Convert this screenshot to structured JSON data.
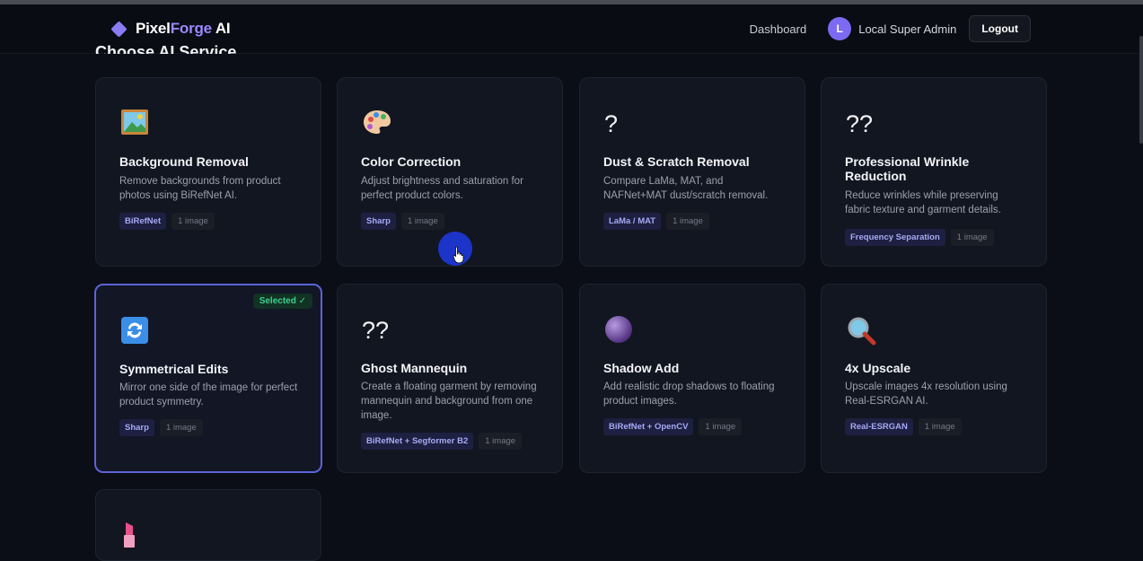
{
  "header": {
    "brand_part1": "Pixel",
    "brand_part2": "Forge",
    "brand_part3": " AI",
    "nav_dashboard": "Dashboard",
    "avatar_initial": "L",
    "user_name": "Local Super Admin",
    "logout_label": "Logout"
  },
  "section": {
    "title": "Choose AI Service"
  },
  "cards": [
    {
      "icon": "framed-picture-icon",
      "title": "Background Removal",
      "desc": "Remove backgrounds from product photos using BiRefNet AI.",
      "tech": "BiRefNet",
      "count": "1 image"
    },
    {
      "icon": "palette-icon",
      "title": "Color Correction",
      "desc": "Adjust brightness and saturation for perfect product colors.",
      "tech": "Sharp",
      "count": "1 image"
    },
    {
      "icon": "question-mark-icon",
      "icon_text": "?",
      "title": "Dust & Scratch Removal",
      "desc": "Compare LaMa, MAT, and NAFNet+MAT dust/scratch removal.",
      "tech": "LaMa / MAT",
      "count": "1 image"
    },
    {
      "icon": "question-mark-icon",
      "icon_text": "??",
      "title": "Professional Wrinkle Reduction",
      "desc": "Reduce wrinkles while preserving fabric texture and garment details.",
      "tech": "Frequency Separation",
      "count": "1 image"
    },
    {
      "icon": "arrows-cycle-icon",
      "title": "Symmetrical Edits",
      "desc": "Mirror one side of the image for perfect product symmetry.",
      "tech": "Sharp",
      "count": "1 image",
      "badge": "Selected ✓"
    },
    {
      "icon": "question-mark-icon",
      "icon_text": "??",
      "title": "Ghost Mannequin",
      "desc": "Create a floating garment by removing mannequin and background from one image.",
      "tech": "BiRefNet + Segformer B2",
      "count": "1 image"
    },
    {
      "icon": "purple-circle-icon",
      "title": "Shadow Add",
      "desc": "Add realistic drop shadows to floating product images.",
      "tech": "BiRefNet + OpenCV",
      "count": "1 image"
    },
    {
      "icon": "magnifier-icon",
      "title": "4x Upscale",
      "desc": "Upscale images 4x resolution using Real-ESRGAN AI.",
      "tech": "Real-ESRGAN",
      "count": "1 image"
    },
    {
      "icon": "lipstick-icon"
    }
  ],
  "colors": {
    "accent": "#8b7cf6",
    "selected_border": "#5d63d6",
    "selected_badge": "#3fcf8e",
    "background": "#0b0e16"
  }
}
